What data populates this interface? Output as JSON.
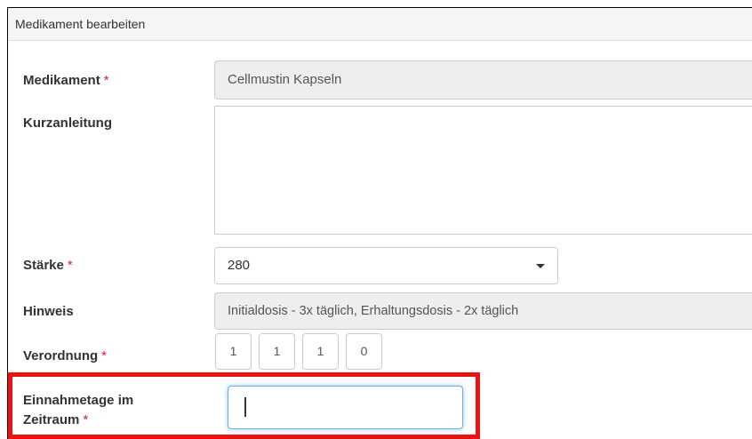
{
  "panel": {
    "title": "Medikament bearbeiten"
  },
  "fields": {
    "medikament": {
      "label": "Medikament",
      "required_mark": "*",
      "value": "Cellmustin Kapseln"
    },
    "kurzanleitung": {
      "label": "Kurzanleitung",
      "value": ""
    },
    "staerke": {
      "label": "Stärke",
      "required_mark": "*",
      "selected": "280"
    },
    "hinweis": {
      "label": "Hinweis",
      "value": "Initialdosis - 3x täglich, Erhaltungsdosis - 2x täglich"
    },
    "verordnung": {
      "label": "Verordnung",
      "required_mark": "*",
      "doses": [
        "1",
        "1",
        "1",
        "0"
      ]
    },
    "einnahmetage": {
      "label_line1": "Einnahmetage im",
      "label_line2": "Zeitraum",
      "required_mark": "*",
      "value": ""
    }
  },
  "colors": {
    "required": "#e0202a",
    "highlight": "#ee1111",
    "focus": "#66afe9"
  },
  "icons": {
    "select_caret": "caret-down-icon"
  }
}
